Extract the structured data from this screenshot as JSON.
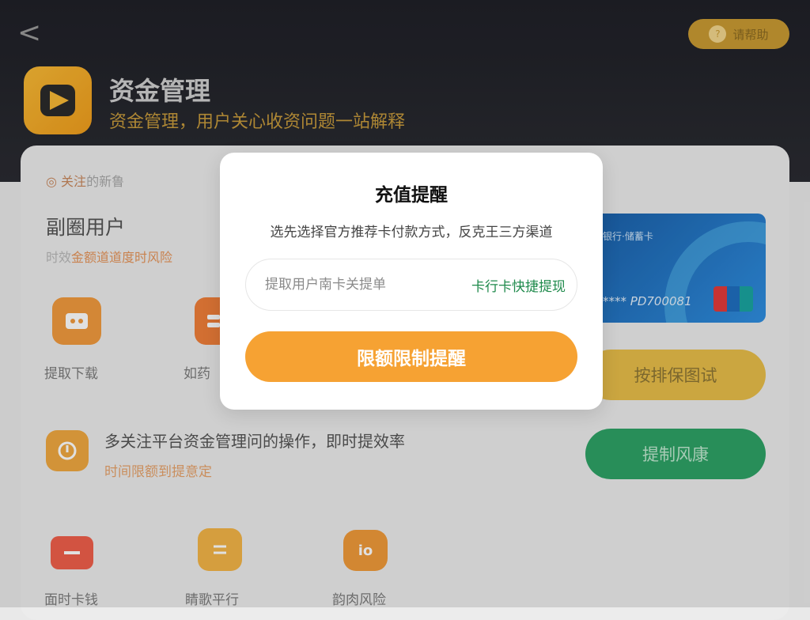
{
  "header": {
    "back_label": "<",
    "help_label": "请帮助",
    "app_title": "资金管理",
    "app_subtitle": "资金管理，用户关心收资问题一站解释"
  },
  "panel": {
    "tag_prefix": "◎ ",
    "tag_text": "关注",
    "tag_suffix": "的新鲁",
    "section_title": "副圈用户",
    "section_sub_prefix": "时效",
    "section_sub_highlight": "金额道道度时风险",
    "icons_row1": [
      {
        "label": "提取下载",
        "color": "#f19a3e",
        "icon": "wallet-icon"
      },
      {
        "label": "如药",
        "color": "#f07f3a",
        "icon": "card-icon"
      }
    ],
    "icons_row3": [
      {
        "label": "面时卡钱",
        "color": "#ef5f4a",
        "icon": "card-icon"
      },
      {
        "label": "睛歌平行",
        "color": "#f3b447",
        "icon": "transfer-icon"
      },
      {
        "label": "韵肉风险",
        "color": "#f09a3a",
        "icon": "shield-icon"
      }
    ],
    "notice_text": "多关注平台资金管理问的操作，即时提效率",
    "notice_sub": "时间限额到提意定",
    "card": {
      "name": "银行·储蓄卡",
      "number": "**** PD700081"
    },
    "side_buttons": [
      "按排保图试",
      "提制风康"
    ]
  },
  "dialog": {
    "title": "充值提醒",
    "description": "选先选择官方推荐卡付款方式，反克王三方渠道",
    "input_placeholder": "提取用户南卡关提单",
    "input_action": "卡行卡快捷提现",
    "primary_button": "限额限制提醒"
  },
  "colors": {
    "accent_orange": "#f6a233",
    "accent_green": "#1f8a4c",
    "header_dark": "#1f2027"
  }
}
